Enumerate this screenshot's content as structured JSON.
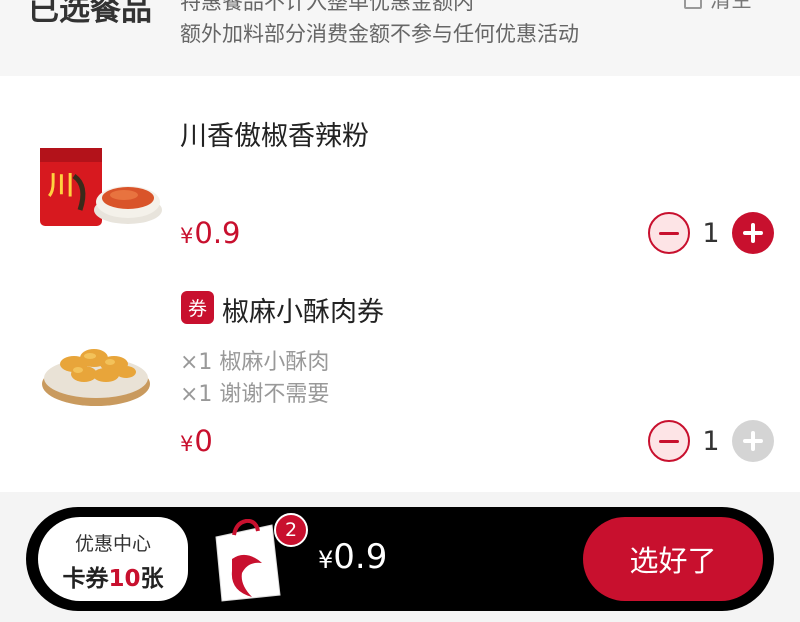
{
  "header": {
    "title": "已选餐品",
    "note_line1": "特惠餐品不计入整单优惠金额内",
    "note_line2": "额外加料部分消费金额不参与任何优惠活动",
    "clear_label": "清空"
  },
  "items": [
    {
      "name": "川香傲椒香辣粉",
      "currency": "¥",
      "price": "0.9",
      "quantity": "1",
      "image_icon": "spicy-powder-packet-icon",
      "plus_enabled": true
    },
    {
      "tag": "券",
      "name": "椒麻小酥肉券",
      "sub_items": [
        "×1 椒麻小酥肉",
        "×1 谢谢不需要"
      ],
      "currency": "¥",
      "price": "0",
      "quantity": "1",
      "image_icon": "crispy-pork-plate-icon",
      "plus_enabled": false
    }
  ],
  "cart_bar": {
    "coupon_center_title": "优惠中心",
    "coupon_count_prefix": "卡券",
    "coupon_count_num": "10",
    "coupon_count_suffix": "张",
    "badge_count": "2",
    "currency": "¥",
    "total": "0.9",
    "checkout_label": "选好了",
    "bag_icon": "shopping-bag-icon"
  },
  "colors": {
    "accent": "#c8102e",
    "bar": "#000000",
    "minus_fill": "#fde4e6",
    "disabled": "#d4d4d4"
  }
}
